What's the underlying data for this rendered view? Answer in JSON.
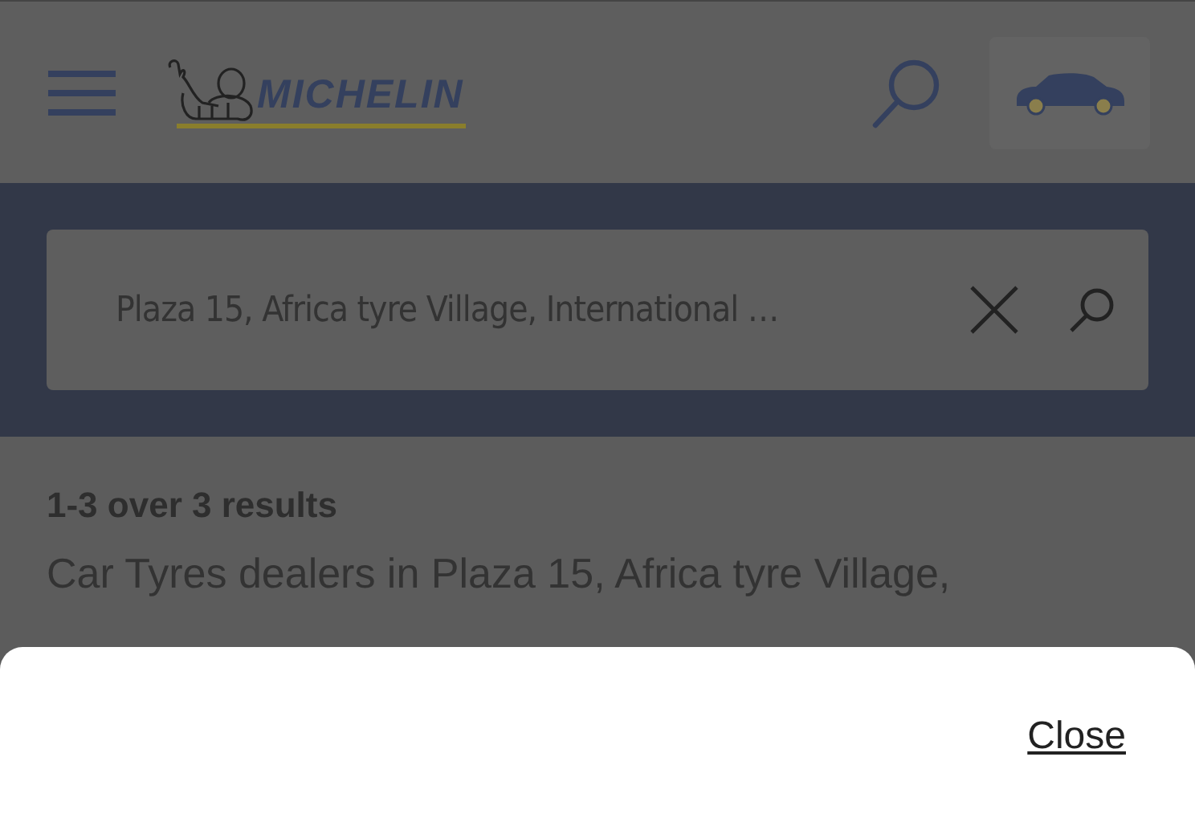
{
  "header": {
    "logo_text": "MICHELIN"
  },
  "search": {
    "value": "Plaza 15, Africa tyre Village, International …"
  },
  "results": {
    "count": "1-3 over 3 results",
    "heading": "Car Tyres dealers in Plaza 15, Africa tyre Village,"
  },
  "sheet": {
    "close_link": "Close"
  }
}
